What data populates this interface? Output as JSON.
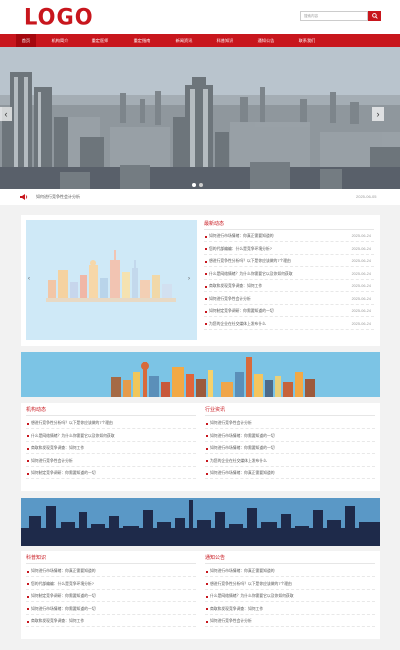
{
  "header": {
    "logo": "LOGO",
    "search_placeholder": "搜索内容"
  },
  "nav": [
    "首页",
    "机构简介",
    "重定医师",
    "重定指南",
    "新闻资讯",
    "科普知识",
    "通知公告",
    "联系我们"
  ],
  "notice": {
    "text": "如何进行竞争性会计分析",
    "date": "2025-06-05"
  },
  "latest": {
    "title": "最新动态",
    "items": [
      {
        "text": "如何进行市场情绪：你真正需要知道的",
        "date": "2025-06-24"
      },
      {
        "text": "您的代部编编：什么是竞争环境分析?",
        "date": "2025-06-24"
      },
      {
        "text": "想进行竞争性分析吗？以下是你应该做的7个理由",
        "date": "2025-06-24"
      },
      {
        "text": "什么是网络情绪？为什么你需要它以及你如何获取",
        "date": "2025-06-24"
      },
      {
        "text": "商取和发现竞争调查：如何工作",
        "date": "2025-06-24"
      },
      {
        "text": "如何进行竞争性会计分析",
        "date": "2025-06-24"
      },
      {
        "text": "如何制定竞争调研：你需要知道的一切",
        "date": "2025-06-24"
      },
      {
        "text": "为您的企业在社交媒体上发布什么",
        "date": "2025-06-24"
      }
    ]
  },
  "org_news": {
    "title": "机构动态",
    "items": [
      "想进行竞争性分析吗？以下是你应该做的7个理由",
      "什么是网络情绪？为什么你需要它以及你如何获取",
      "商取和发现竞争调查：如何工作",
      "如何进行竞争性会计分析",
      "如何制定竞争调研：你需要知道的一切"
    ]
  },
  "industry": {
    "title": "行业资讯",
    "items": [
      "如何进行竞争性会计分析",
      "如何进行市场情绪：你需要知道的一切",
      "如何进行市场情绪：你需要知道的一切",
      "为您的企业在社交媒体上发布什么",
      "如何进行市场情绪：你真正需要知道的"
    ]
  },
  "science": {
    "title": "科普知识",
    "items": [
      "如何进行市场情绪：你真正需要知道的",
      "您的代部编编：什么是竞争环境分析?",
      "如何制定竞争调研：你需要知道的一切",
      "如何进行市场情绪：你需要知道的一切",
      "商取和发现竞争调查：如何工作"
    ]
  },
  "announce": {
    "title": "通知公告",
    "items": [
      "如何进行市场情绪：你真正需要知道的",
      "想进行竞争性分析吗？以下是你应该做的7个理由",
      "什么是网络情绪？为什么你需要它以及你如何获取",
      "商取和发现竞争调查：如何工作",
      "如何进行竞争性会计分析"
    ]
  },
  "colors": {
    "brand": "#c8161d",
    "nav_active": "#a5080e",
    "sky": "#7cc4e5",
    "navy": "#1e2a4a"
  }
}
